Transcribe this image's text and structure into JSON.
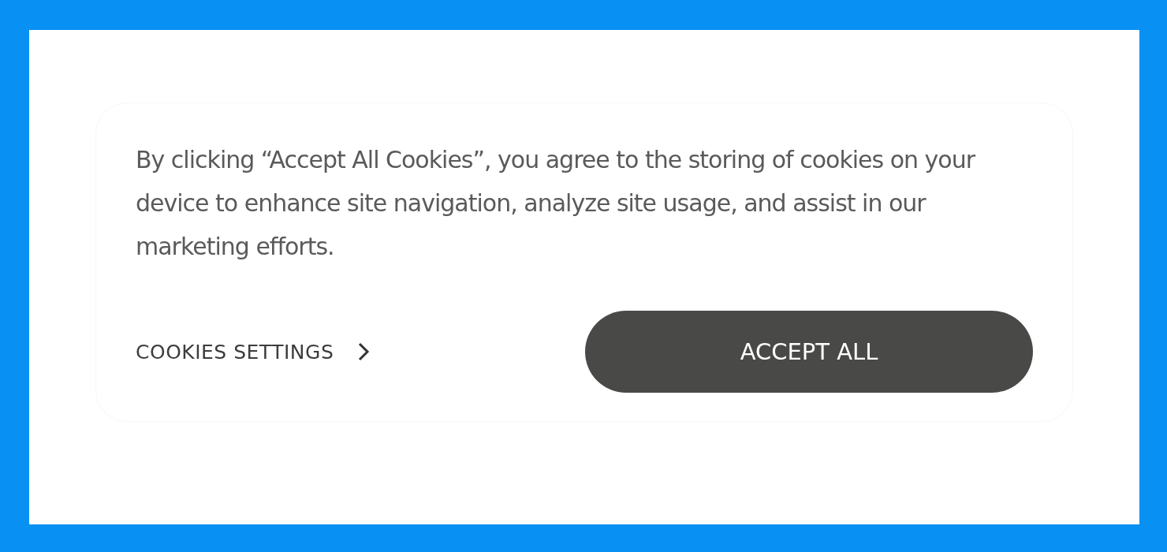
{
  "banner": {
    "message": "By clicking “Accept All Cookies”, you agree to the storing of cookies on your device to enhance site navigation, analyze site usage, and assist in our marketing efforts.",
    "settings_link": "COOKIES SETTINGS",
    "accept_button": "ACCEPT ALL"
  }
}
